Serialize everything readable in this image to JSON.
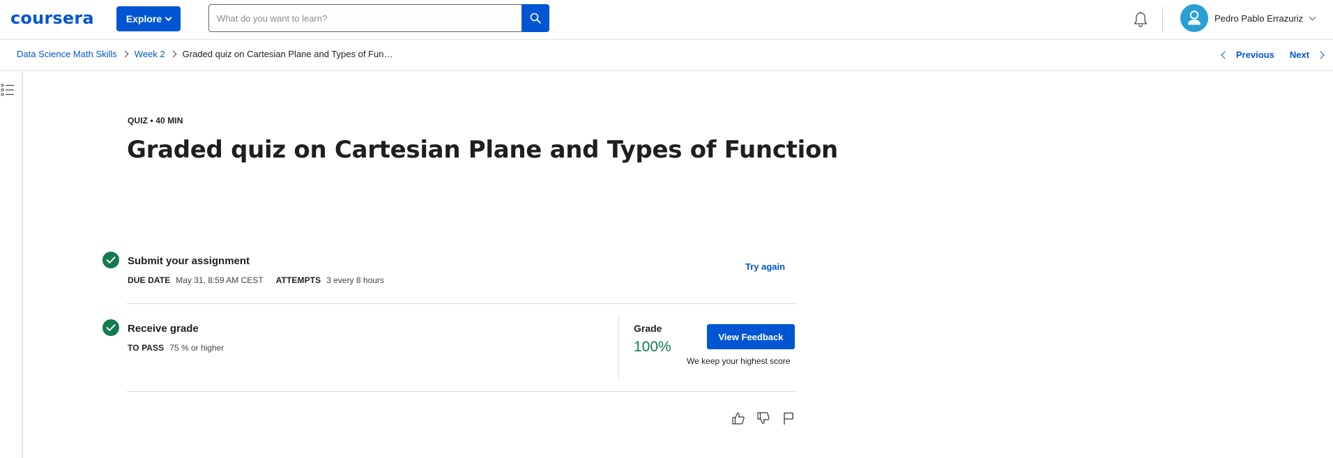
{
  "header": {
    "logo_text": "coursera",
    "explore_label": "Explore",
    "search": {
      "placeholder": "What do you want to learn?",
      "value": ""
    },
    "icons": {
      "search": "search-icon",
      "notifications": "bell-icon",
      "avatar": "user-avatar-icon"
    },
    "user_name": "Pedro Pablo Errazuriz"
  },
  "breadcrumb": {
    "items": [
      "Data Science Math Skills",
      "Week 2"
    ],
    "current": "Graded quiz on Cartesian Plane and Types of Fun…"
  },
  "navigation": {
    "previous_label": "Previous",
    "next_label": "Next"
  },
  "quiz": {
    "meta": "QUIZ • 40 MIN",
    "title": "Graded quiz on Cartesian Plane and Types of Function"
  },
  "submit_step": {
    "title": "Submit your assignment",
    "due_date_label": "DUE DATE",
    "due_date_value": "May 31, 8:59 AM CEST",
    "attempts_label": "ATTEMPTS",
    "attempts_value": "3 every 8 hours",
    "try_again_label": "Try again"
  },
  "grade_step": {
    "title": "Receive grade",
    "to_pass_label": "TO PASS",
    "to_pass_value": "75 % or higher",
    "grade_label": "Grade",
    "grade_value": "100%",
    "view_feedback_label": "View Feedback",
    "keep_score_note": "We keep your highest score"
  },
  "colors": {
    "brand_blue": "#0056d2",
    "success_green": "#137a4f",
    "avatar_blue": "#2a9fd6"
  }
}
